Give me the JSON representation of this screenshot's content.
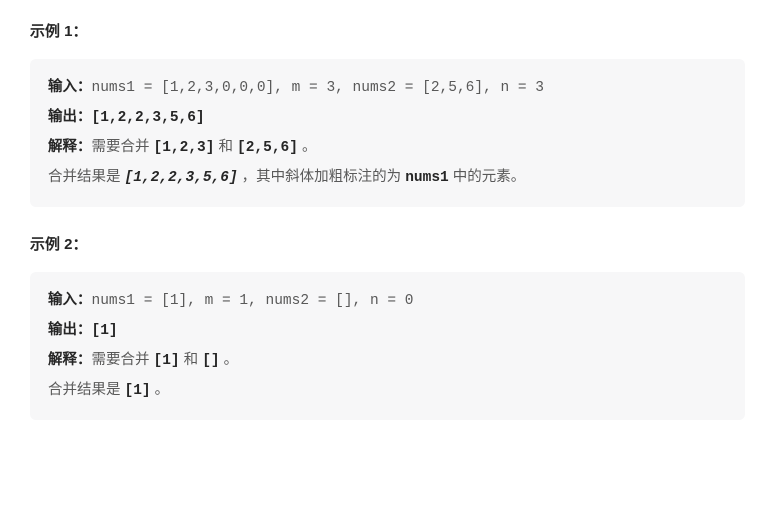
{
  "examples": [
    {
      "heading": "示例 1：",
      "input_label": "输入：",
      "input_text": "nums1 = [1,2,3,0,0,0], m = 3, nums2 = [2,5,6], n = 3",
      "output_label": "输出：",
      "output_text": "[1,2,2,3,5,6]",
      "explain_label": "解释：",
      "explain_prefix": "需要合并 ",
      "explain_arr1": "[1,2,3]",
      "explain_and": " 和 ",
      "explain_arr2": "[2,5,6]",
      "explain_period": " 。",
      "result_prefix": "合并结果是 ",
      "result_arr": "[1,2,2,3,5,6]",
      "result_mid": " ，其中斜体加粗标注的为 ",
      "result_nums1": "nums1",
      "result_suffix": " 中的元素。"
    },
    {
      "heading": "示例 2：",
      "input_label": "输入：",
      "input_text": "nums1 = [1], m = 1, nums2 = [], n = 0",
      "output_label": "输出：",
      "output_text": "[1]",
      "explain_label": "解释：",
      "explain_prefix": "需要合并 ",
      "explain_arr1": "[1]",
      "explain_and": " 和 ",
      "explain_arr2": "[]",
      "explain_period": " 。",
      "result_prefix": "合并结果是 ",
      "result_arr": "[1]",
      "result_suffix2": " 。"
    }
  ]
}
